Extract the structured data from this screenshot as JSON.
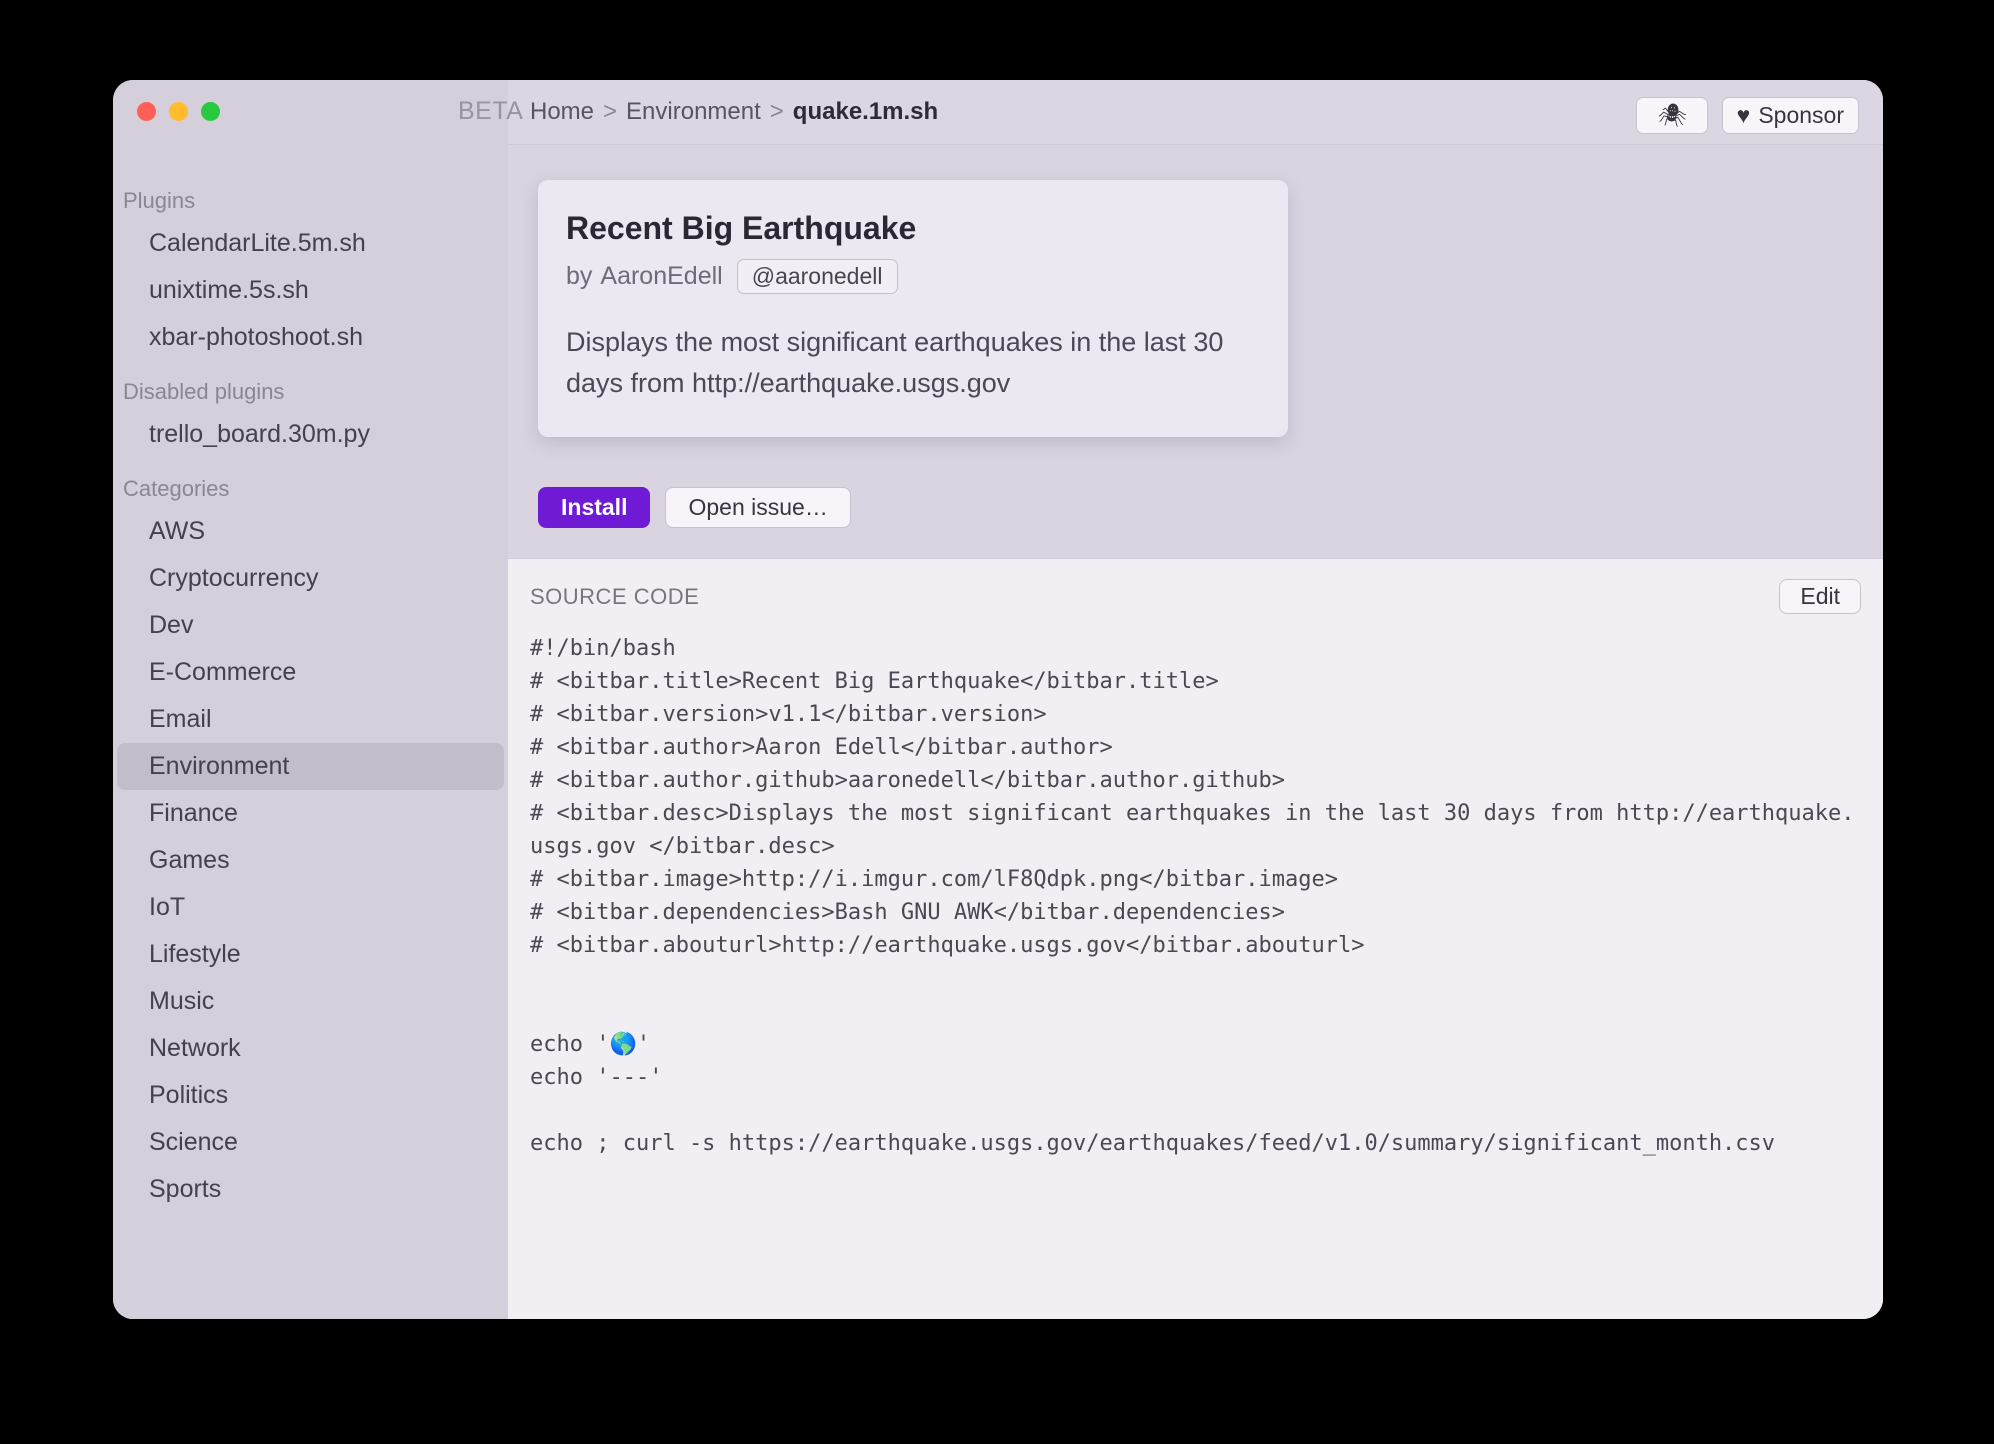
{
  "titlebar": {
    "beta_label": "BETA",
    "bug_icon": "🕷",
    "sponsor_icon": "♥",
    "sponsor_label": "Sponsor"
  },
  "sidebar": {
    "plugins_label": "Plugins",
    "plugins": [
      "CalendarLite.5m.sh",
      "unixtime.5s.sh",
      "xbar-photoshoot.sh"
    ],
    "disabled_label": "Disabled plugins",
    "disabled": [
      "trello_board.30m.py"
    ],
    "categories_label": "Categories",
    "categories": [
      "AWS",
      "Cryptocurrency",
      "Dev",
      "E-Commerce",
      "Email",
      "Environment",
      "Finance",
      "Games",
      "IoT",
      "Lifestyle",
      "Music",
      "Network",
      "Politics",
      "Science",
      "Sports"
    ],
    "selected_category": "Environment"
  },
  "breadcrumb": {
    "home": "Home",
    "sep": ">",
    "category": "Environment",
    "current": "quake.1m.sh"
  },
  "plugin": {
    "title": "Recent Big Earthquake",
    "by_prefix": "by",
    "author": "AaronEdell",
    "handle": "@aaronedell",
    "description": "Displays the most significant earthquakes in the last 30 days from http://earthquake.usgs.gov",
    "install_label": "Install",
    "open_issue_label": "Open issue…"
  },
  "source": {
    "label": "SOURCE CODE",
    "edit_label": "Edit",
    "code": "#!/bin/bash\n# <bitbar.title>Recent Big Earthquake</bitbar.title>\n# <bitbar.version>v1.1</bitbar.version>\n# <bitbar.author>Aaron Edell</bitbar.author>\n# <bitbar.author.github>aaronedell</bitbar.author.github>\n# <bitbar.desc>Displays the most significant earthquakes in the last 30 days from http://earthquake.usgs.gov </bitbar.desc>\n# <bitbar.image>http://i.imgur.com/lF8Qdpk.png</bitbar.image>\n# <bitbar.dependencies>Bash GNU AWK</bitbar.dependencies>\n# <bitbar.abouturl>http://earthquake.usgs.gov</bitbar.abouturl>\n\n\necho '🌎'\necho '---'\n\necho ; curl -s https://earthquake.usgs.gov/earthquakes/feed/v1.0/summary/significant_month.csv"
  }
}
